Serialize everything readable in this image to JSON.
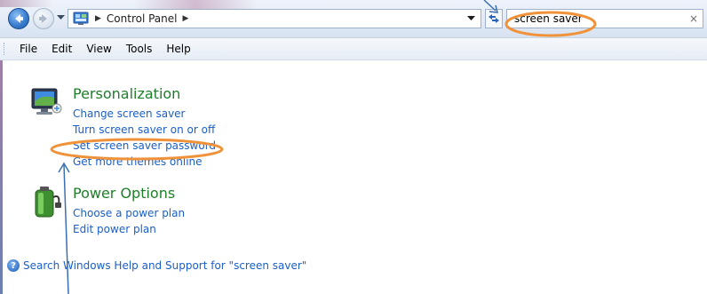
{
  "address_bar": {
    "path": [
      "Control Panel"
    ],
    "separator": "▶"
  },
  "search": {
    "value": "screen saver",
    "clear_glyph": "×"
  },
  "menu": {
    "items": [
      "File",
      "Edit",
      "View",
      "Tools",
      "Help"
    ]
  },
  "categories": [
    {
      "title": "Personalization",
      "icon": "monitor-icon",
      "links": [
        "Change screen saver",
        "Turn screen saver on or off",
        "Set screen saver password",
        "Get more themes online"
      ]
    },
    {
      "title": "Power Options",
      "icon": "battery-icon",
      "links": [
        "Choose a power plan",
        "Edit power plan"
      ]
    }
  ],
  "help": {
    "text": "Search Windows Help and Support for \"screen saver\"",
    "icon": "help-icon",
    "glyph": "?"
  },
  "colors": {
    "link": "#1a5fc9",
    "category_title": "#1e7e2a",
    "annotation_ellipse": "#f0923a",
    "annotation_arrow": "#3a6fb2"
  }
}
